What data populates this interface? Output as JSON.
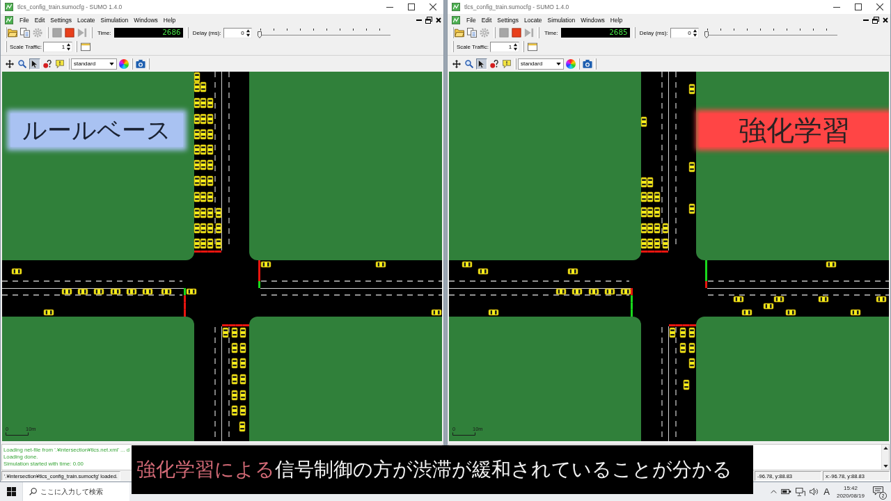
{
  "windows": [
    {
      "title": "tlcs_config_train.sumocfg - SUMO 1.4.0",
      "menus": [
        "File",
        "Edit",
        "Settings",
        "Locate",
        "Simulation",
        "Windows",
        "Help"
      ],
      "file_tools": [
        {
          "kind": "open",
          "disabled": false
        },
        {
          "kind": "reload",
          "disabled": false
        },
        {
          "kind": "recycle",
          "disabled": true
        }
      ],
      "sim_tools": [
        {
          "kind": "start",
          "disabled": true
        },
        {
          "kind": "stop",
          "disabled": false
        },
        {
          "kind": "step",
          "disabled": true
        }
      ],
      "time_label": "Time:",
      "time": "2686",
      "delay_label": "Delay (ms):",
      "delay": "0",
      "delay_slider": {
        "level": 0
      },
      "scale_label": "Scale Traffic:",
      "scale": "1",
      "view_tools": [
        {
          "kind": "pan",
          "selected": false
        },
        {
          "kind": "zoom",
          "selected": false
        },
        {
          "kind": "select",
          "selected": true
        },
        {
          "kind": "locate",
          "selected": false
        },
        {
          "kind": "tooltip",
          "selected": false
        }
      ],
      "scheme": "standard",
      "method_label": {
        "text": "ルールベース",
        "color": "#a9c2f2"
      },
      "signals": {
        "north": [
          {
            "green": false
          },
          {
            "green": false
          },
          {
            "green": false
          },
          {
            "green": false
          }
        ],
        "south": [
          {
            "green": false
          },
          {
            "green": false
          },
          {
            "green": false
          },
          {
            "green": false
          }
        ],
        "west": [
          {
            "green": false
          },
          {
            "green": false
          },
          {
            "green": false
          },
          {
            "green": true
          }
        ],
        "east": [
          {
            "green": false
          },
          {
            "green": false
          },
          {
            "green": false
          },
          {
            "green": true
          }
        ]
      },
      "scale_bar": {
        "start": "0",
        "end": "10m"
      },
      "log": [
        "Loading net-file from '.¥intersection¥tlcs.net.xml' ... d",
        "Loading done.",
        "Simulation started with time: 0.00"
      ],
      "status_fields": [
        {
          "kind": "message",
          "text": "'.¥intersection¥tlcs_config_train.sumocfg' loaded."
        }
      ]
    },
    {
      "title": "tlcs_config_train.sumocfg - SUMO 1.4.0",
      "menus": [
        "File",
        "Edit",
        "Settings",
        "Locate",
        "Simulation",
        "Windows",
        "Help"
      ],
      "file_tools": [
        {
          "kind": "open",
          "disabled": false
        },
        {
          "kind": "reload",
          "disabled": false
        },
        {
          "kind": "recycle",
          "disabled": true
        }
      ],
      "sim_tools": [
        {
          "kind": "start",
          "disabled": true
        },
        {
          "kind": "stop",
          "disabled": false
        },
        {
          "kind": "step",
          "disabled": true
        }
      ],
      "time_label": "Time:",
      "time": "2685",
      "delay_label": "Delay (ms):",
      "delay": "0",
      "delay_slider": {
        "level": 0
      },
      "scale_label": "Scale Traffic:",
      "scale": "1",
      "view_tools": [
        {
          "kind": "pan",
          "selected": false
        },
        {
          "kind": "zoom",
          "selected": false
        },
        {
          "kind": "select",
          "selected": true
        },
        {
          "kind": "locate",
          "selected": false
        },
        {
          "kind": "tooltip",
          "selected": false
        }
      ],
      "scheme": "standard",
      "method_label": {
        "text": "強化学習",
        "color": "#ff4545"
      },
      "signals": {
        "north": [
          {
            "green": false
          },
          {
            "green": false
          },
          {
            "green": false
          },
          {
            "green": false
          }
        ],
        "south": [
          {
            "green": false
          },
          {
            "green": false
          },
          {
            "green": false
          },
          {
            "green": false
          }
        ],
        "west": [
          {
            "green": true
          },
          {
            "green": true
          },
          {
            "green": true
          },
          {
            "green": false
          }
        ],
        "east": [
          {
            "green": true
          },
          {
            "green": true
          },
          {
            "green": true
          },
          {
            "green": false
          }
        ]
      },
      "scale_bar": {
        "start": "0",
        "end": "10m"
      },
      "status_fields": [
        {
          "kind": "coords",
          "text": "-96.78, y:88.83"
        },
        {
          "kind": "coords",
          "text": "x:-96.78, y:88.83"
        }
      ]
    }
  ],
  "caption": {
    "segments": [
      {
        "text": "強化学習による",
        "color": "#d26a76"
      },
      {
        "text": "信号制御の方が渋滞が緩和されていることが分かる",
        "color": "#f2f2f2"
      }
    ]
  },
  "taskbar": {
    "search": {
      "placeholder": "ここに入力して検索"
    },
    "tray": {
      "ime": "A",
      "time": "15:42",
      "date": "2020/08/19",
      "notifications": "2"
    }
  }
}
